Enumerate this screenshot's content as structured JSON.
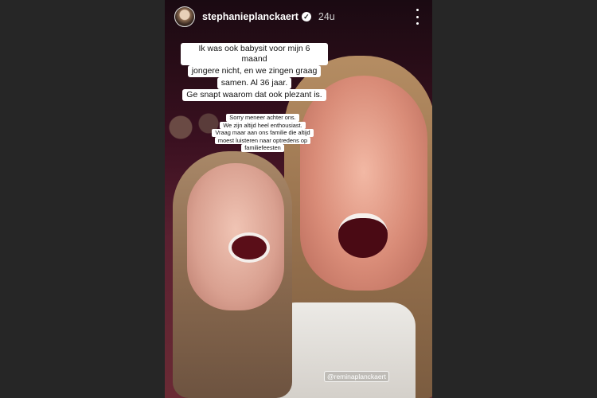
{
  "story": {
    "username": "stephanieplanckaert",
    "timestamp": "24u",
    "caption_main": [
      "Ik was ook babysit voor mijn 6 maand",
      "jongere nicht, en we zingen graag",
      "samen. Al 36 jaar.",
      "Ge snapt waarom dat ook plezant is."
    ],
    "caption_secondary": [
      "Sorry meneer achter ons.",
      "We zijn altijd heel enthousiast.",
      "Vraag maar aan ons familie die altijd",
      "moest luisteren naar optredens op",
      "familiefeesten"
    ],
    "mention": "@reminaplanckaert"
  },
  "icons": {
    "verified": "verified-badge-icon",
    "more": "more-options-icon",
    "avatar": "profile-avatar"
  },
  "colors": {
    "background": "#262626",
    "text_on_dark": "#ffffff",
    "sticker_bg": "#ffffff"
  }
}
